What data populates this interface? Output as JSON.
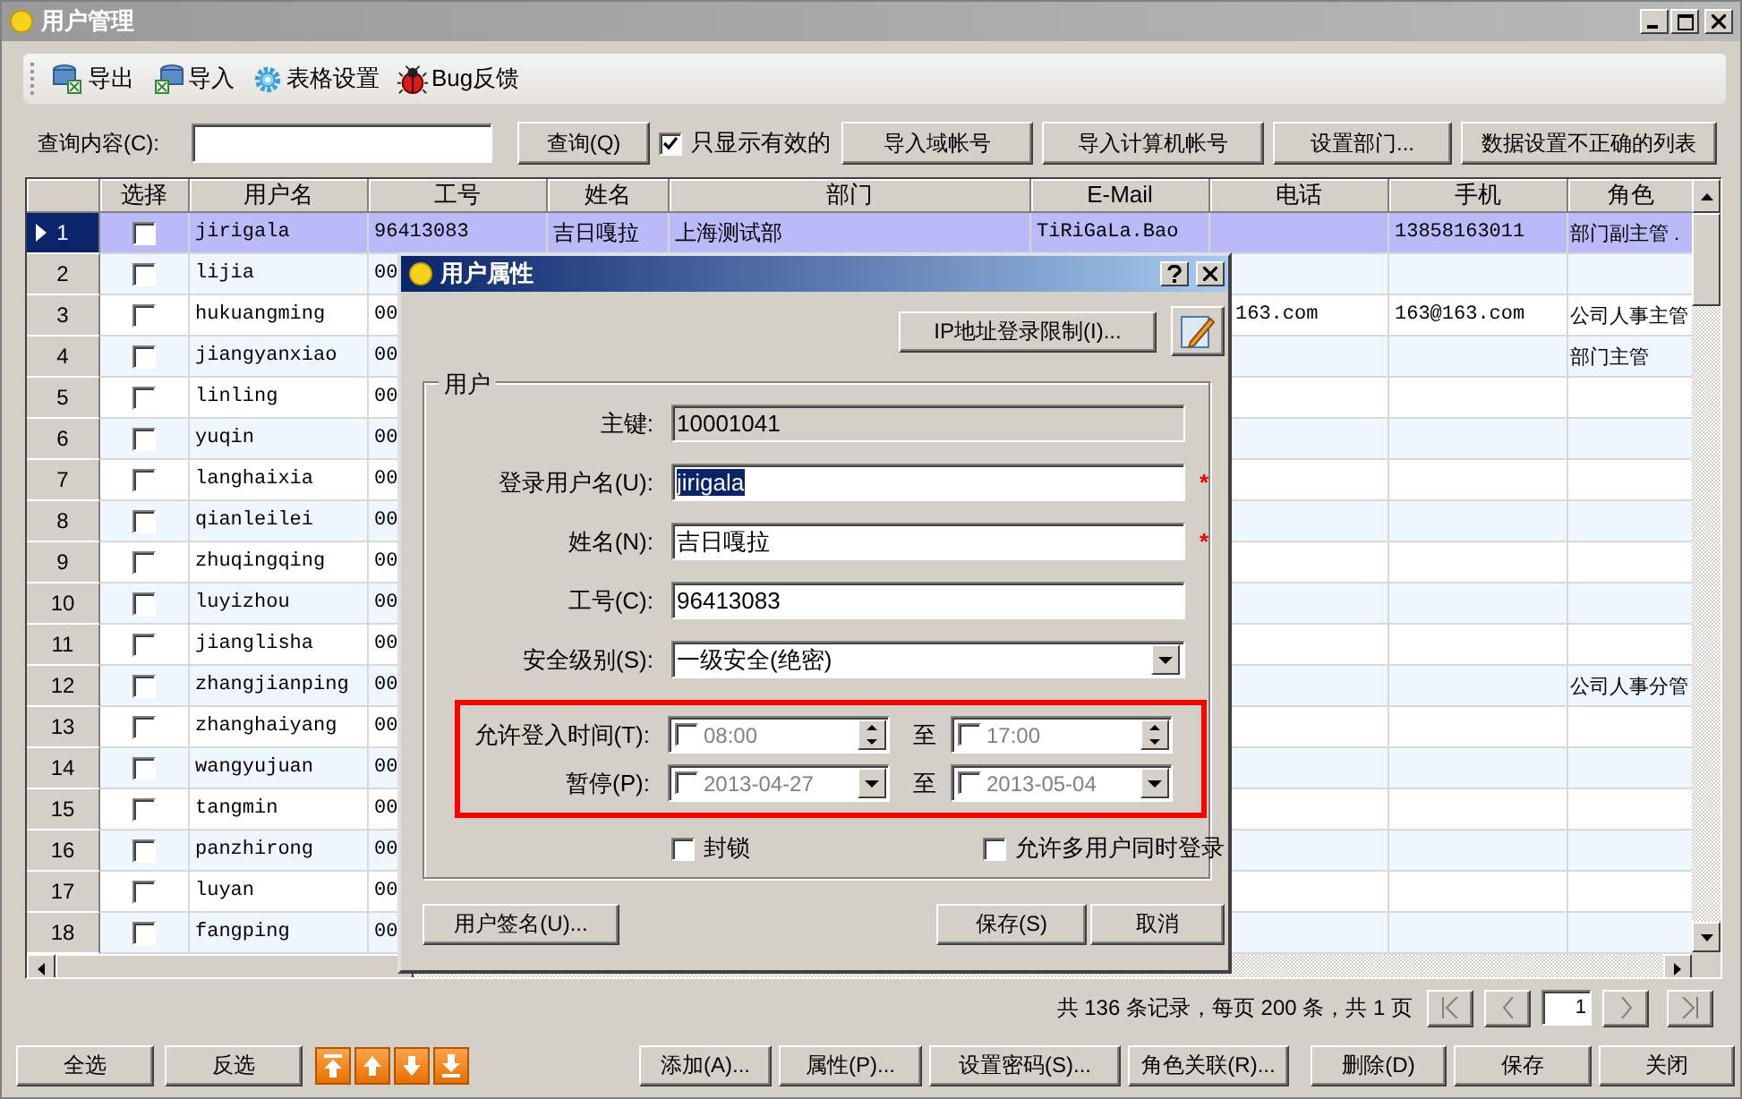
{
  "window": {
    "title": "用户管理"
  },
  "toolbar": [
    {
      "kind": "export",
      "label": "导出"
    },
    {
      "kind": "import",
      "label": "导入"
    },
    {
      "kind": "settings",
      "label": "表格设置"
    },
    {
      "kind": "bug",
      "label": "Bug反馈"
    }
  ],
  "query": {
    "label": "查询内容(C):",
    "button": "查询(Q)",
    "only_valid": {
      "label": "只显示有效的",
      "checked": true
    },
    "actions": [
      "导入域帐号",
      "导入计算机帐号",
      "设置部门...",
      "数据设置不正确的列表"
    ]
  },
  "table": {
    "columns": [
      "选择",
      "用户名",
      "工号",
      "姓名",
      "部门",
      "E-Mail",
      "电话",
      "手机",
      "角色"
    ],
    "rows": [
      {
        "number": "1",
        "selected": true,
        "checked": false,
        "username": "jirigala",
        "employee_id": "96413083",
        "name": "吉日嘎拉",
        "department": "上海测试部",
        "email": "TiRiGaLa.Bao",
        "mobile": "13858163011",
        "role": "部门副主管 ."
      },
      {
        "number": "2",
        "selected": false,
        "checked": false,
        "username": "lijia",
        "employee_id": "00"
      },
      {
        "number": "3",
        "selected": false,
        "checked": false,
        "username": "hukuangming",
        "employee_id": "00",
        "phone": "163.com",
        "mobile": "163@163.com",
        "role": "公司人事主管"
      },
      {
        "number": "4",
        "selected": false,
        "checked": false,
        "username": "jiangyanxiao",
        "employee_id": "00",
        "role": "部门主管"
      },
      {
        "number": "5",
        "selected": false,
        "checked": false,
        "username": "linling",
        "employee_id": "00"
      },
      {
        "number": "6",
        "selected": false,
        "checked": false,
        "username": "yuqin",
        "employee_id": "00"
      },
      {
        "number": "7",
        "selected": false,
        "checked": false,
        "username": "langhaixia",
        "employee_id": "00"
      },
      {
        "number": "8",
        "selected": false,
        "checked": false,
        "username": "qianleilei",
        "employee_id": "00"
      },
      {
        "number": "9",
        "selected": false,
        "checked": false,
        "username": "zhuqingqing",
        "employee_id": "00"
      },
      {
        "number": "10",
        "selected": false,
        "checked": false,
        "username": "luyizhou",
        "employee_id": "00"
      },
      {
        "number": "11",
        "selected": false,
        "checked": false,
        "username": "jianglisha",
        "employee_id": "00"
      },
      {
        "number": "12",
        "selected": false,
        "checked": false,
        "username": "zhangjianping",
        "employee_id": "00",
        "role": "公司人事分管"
      },
      {
        "number": "13",
        "selected": false,
        "checked": false,
        "username": "zhanghaiyang",
        "employee_id": "00"
      },
      {
        "number": "14",
        "selected": false,
        "checked": false,
        "username": "wangyujuan",
        "employee_id": "00"
      },
      {
        "number": "15",
        "selected": false,
        "checked": false,
        "username": "tangmin",
        "employee_id": "00"
      },
      {
        "number": "16",
        "selected": false,
        "checked": false,
        "username": "panzhirong",
        "employee_id": "00"
      },
      {
        "number": "17",
        "selected": false,
        "checked": false,
        "username": "luyan",
        "employee_id": "00"
      },
      {
        "number": "18",
        "selected": false,
        "checked": false,
        "username": "fangping",
        "employee_id": "00"
      }
    ]
  },
  "pagination": {
    "summary": "共 136 条记录，每页 200 条，共 1 页",
    "page": "1"
  },
  "selection_buttons": [
    "全选",
    "反选"
  ],
  "actions": [
    "添加(A)...",
    "属性(P)...",
    "设置密码(S)...",
    "角色关联(R)...",
    "删除(D)",
    "保存",
    "关闭"
  ],
  "dialog": {
    "title": "用户属性",
    "ip_button": "IP地址登录限制(I)...",
    "group_title": "用户",
    "fields": [
      {
        "kind": "readonly",
        "label": "主键:",
        "value": "10001041"
      },
      {
        "kind": "text",
        "label": "登录用户名(U):",
        "value": "jirigala",
        "text_selected": true,
        "required_mark": "*"
      },
      {
        "kind": "text",
        "label": "姓名(N):",
        "value": "吉日嘎拉",
        "text_selected": false,
        "required_mark": "*"
      },
      {
        "kind": "text",
        "label": "工号(C):",
        "value": "96413083",
        "text_selected": false
      },
      {
        "kind": "select",
        "label": "安全级别(S):",
        "value": "一级安全(绝密)"
      }
    ],
    "restrictions_highlighted": true,
    "restrictions": [
      {
        "kind": "time",
        "label": "允许登入时间(T):",
        "separator": "至",
        "from": {
          "value": "08:00",
          "checked": false
        },
        "to": {
          "value": "17:00",
          "checked": false
        }
      },
      {
        "kind": "date",
        "label": "暂停(P):",
        "separator": "至",
        "from": {
          "value": "2013-04-27",
          "checked": false
        },
        "to": {
          "value": "2013-05-04",
          "checked": false
        }
      }
    ],
    "options": [
      {
        "label": "封锁",
        "checked": false
      },
      {
        "label": "允许多用户同时登录",
        "checked": false
      }
    ],
    "signature_button": "用户签名(U)...",
    "save_button": "保存(S)",
    "cancel_button": "取消"
  }
}
